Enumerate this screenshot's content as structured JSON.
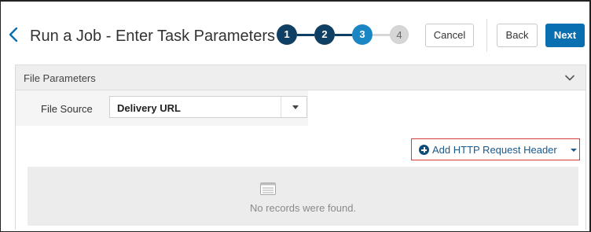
{
  "header": {
    "title": "Run a Job - Enter Task Parameters",
    "steps": [
      "1",
      "2",
      "3",
      "4"
    ],
    "cancel_label": "Cancel",
    "back_label": "Back",
    "next_label": "Next",
    "colors": {
      "step_done": "#0f3f62",
      "step_current": "#1b86c4",
      "step_pending": "#d6d6d6",
      "primary": "#0a6fb0"
    }
  },
  "section": {
    "title": "File Parameters",
    "file_source_label": "File Source",
    "file_source_value": "Delivery URL",
    "add_header_label": "Add HTTP Request Header",
    "empty_message": "No records were found."
  }
}
